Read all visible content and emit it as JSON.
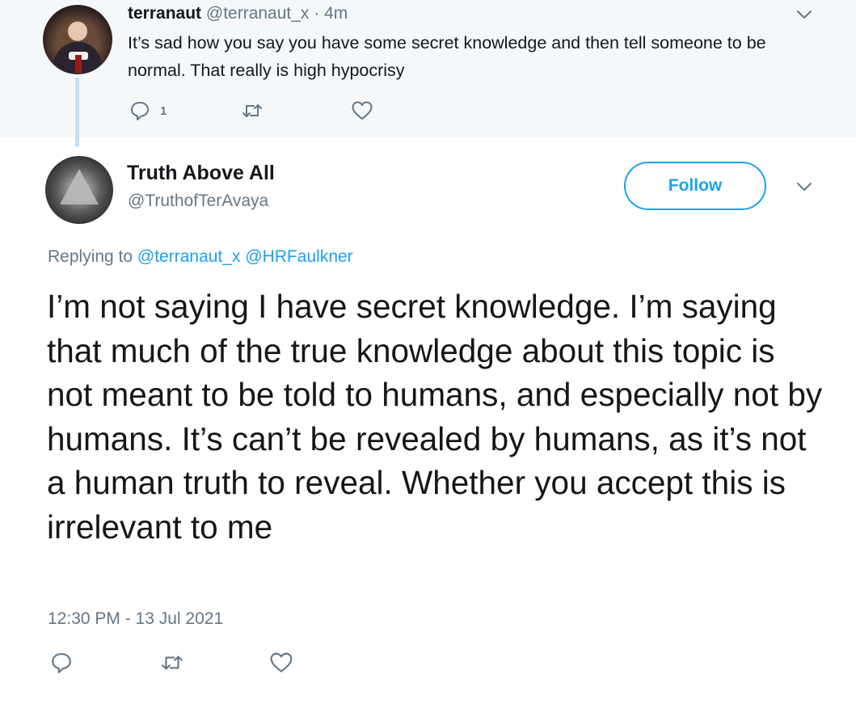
{
  "parent_tweet": {
    "display_name": "terranaut",
    "handle": "@terranaut_x",
    "separator": "·",
    "time": "4m",
    "text": "It’s sad how you say you have some secret knowledge and then tell someone to be normal. That really is high hypocrisy",
    "reply_count": "1"
  },
  "main_tweet": {
    "display_name": "Truth Above All",
    "handle": "@TruthofTerAvaya",
    "follow_label": "Follow",
    "replying_prefix": "Replying to",
    "mentions": [
      "@terranaut_x",
      "@HRFaulkner"
    ],
    "text": "I’m not saying I have secret knowledge. I’m saying that much of the true knowledge about this topic is not meant to be told to humans, and especially not by humans. It’s can’t be revealed by humans, as it’s not a human truth to reveal. Whether you accept this is irrelevant to me",
    "timestamp": "12:30 PM - 13 Jul 2021"
  },
  "icons": {
    "reply": "reply-icon",
    "retweet": "retweet-icon",
    "like": "heart-icon",
    "more": "chevron-down-icon"
  },
  "colors": {
    "accent": "#1da1f2",
    "secondary_text": "#657786",
    "parent_bg": "#f5f8fa",
    "thread_line": "#c4e1f7"
  }
}
